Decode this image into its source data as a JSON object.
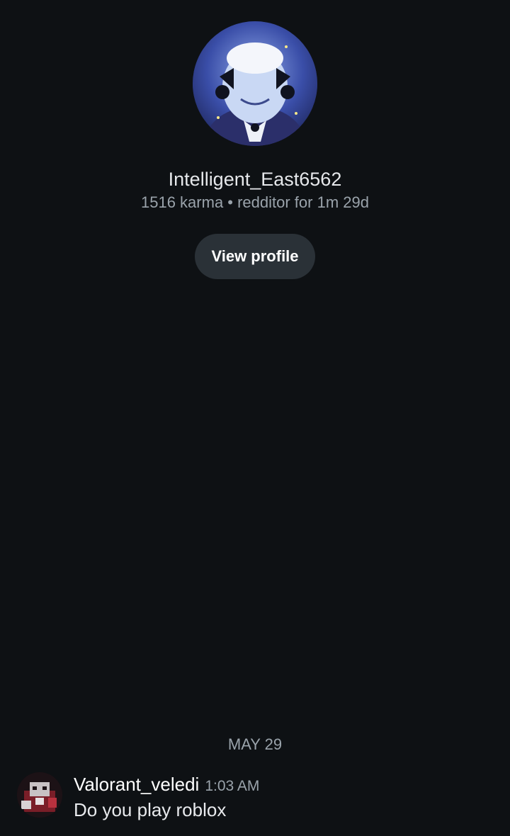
{
  "profile": {
    "avatar_icon": "user-avatar-maid-character",
    "username": "Intelligent_East6562",
    "meta": "1516 karma • redditor for 1m 29d",
    "view_profile_label": "View profile"
  },
  "conversation": {
    "date_separator": "MAY 29",
    "messages": [
      {
        "avatar_icon": "user-avatar",
        "author": "Valorant_veledi",
        "time": "1:03 AM",
        "text": "Do you play roblox"
      }
    ]
  },
  "colors": {
    "background": "#0e1114",
    "button_bg": "#2a3137",
    "secondary_text": "#9aa3ab",
    "primary_text": "#e8eaed"
  }
}
